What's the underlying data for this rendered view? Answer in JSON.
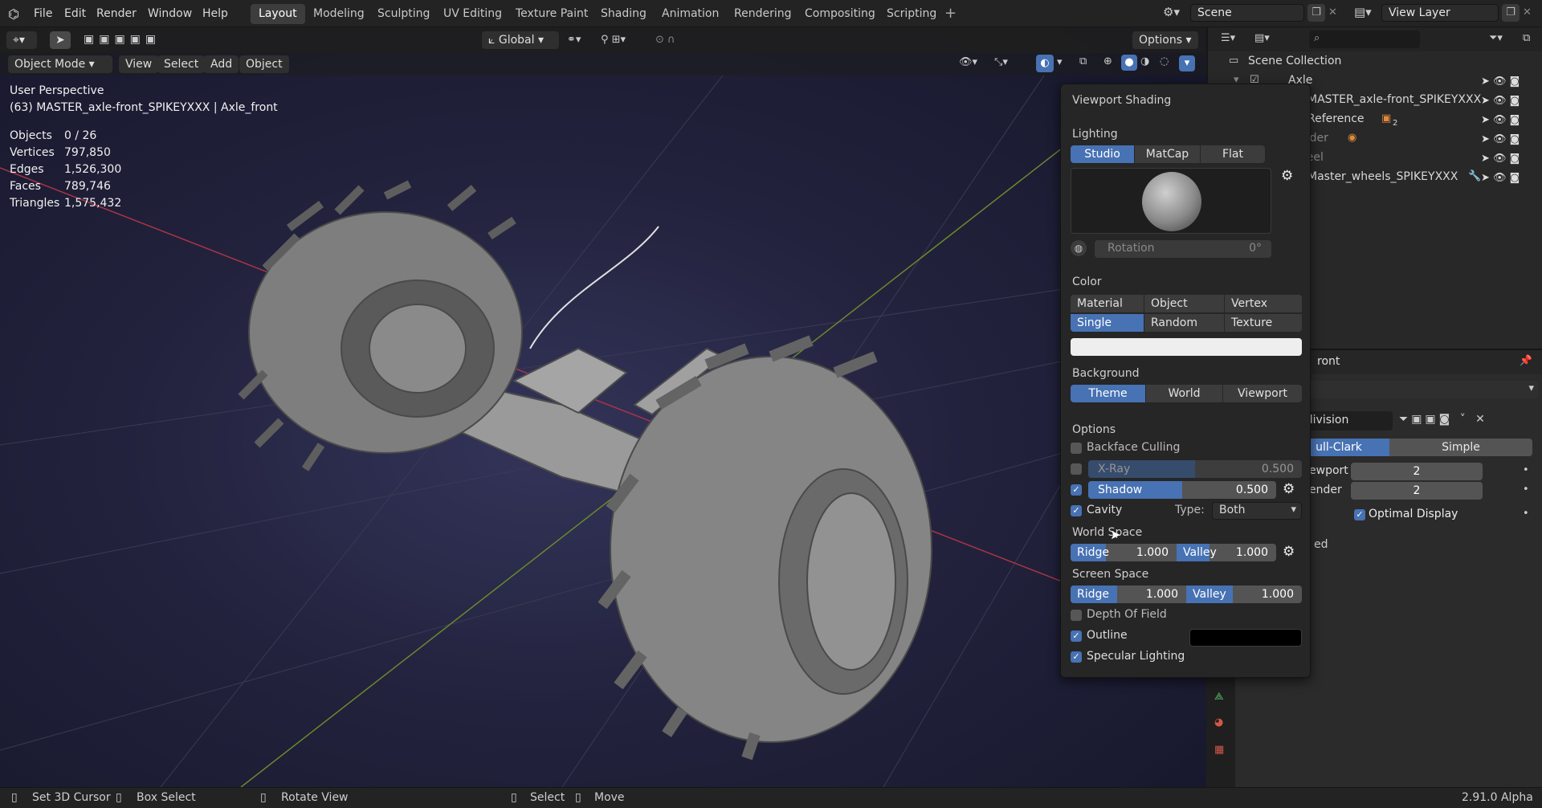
{
  "menu": [
    "File",
    "Edit",
    "Render",
    "Window",
    "Help"
  ],
  "workspaces": [
    "Layout",
    "Modeling",
    "Sculpting",
    "UV Editing",
    "Texture Paint",
    "Shading",
    "Animation",
    "Rendering",
    "Compositing",
    "Scripting"
  ],
  "active_workspace": "Layout",
  "scene": "Scene",
  "view_layer": "View Layer",
  "toolbar": {
    "orientation": "Global",
    "options": "Options"
  },
  "viewport_header": {
    "mode": "Object Mode",
    "view": "View",
    "select": "Select",
    "add": "Add",
    "object": "Object"
  },
  "overlay": {
    "perspective": "User Perspective",
    "object_info": "(63) MASTER_axle-front_SPIKEYXXX | Axle_front",
    "stats": [
      {
        "label": "Objects",
        "value": "0 / 26"
      },
      {
        "label": "Vertices",
        "value": "797,850"
      },
      {
        "label": "Edges",
        "value": "1,526,300"
      },
      {
        "label": "Faces",
        "value": "789,746"
      },
      {
        "label": "Triangles",
        "value": "1,575,432"
      }
    ]
  },
  "shading": {
    "title": "Viewport Shading",
    "lighting_label": "Lighting",
    "lighting": [
      "Studio",
      "MatCap",
      "Flat"
    ],
    "rotation_label": "Rotation",
    "rotation_value": "0°",
    "color_label": "Color",
    "color_row1": [
      "Material",
      "Object",
      "Vertex"
    ],
    "color_row2": [
      "Single",
      "Random",
      "Texture"
    ],
    "background_label": "Background",
    "background": [
      "Theme",
      "World",
      "Viewport"
    ],
    "options_label": "Options",
    "backface": "Backface Culling",
    "xray_label": "X-Ray",
    "xray_value": "0.500",
    "shadow_label": "Shadow",
    "shadow_value": "0.500",
    "cavity": "Cavity",
    "type_label": "Type:",
    "type_value": "Both",
    "world_space": "World Space",
    "ridge": "Ridge",
    "valley": "Valley",
    "ws_ridge": "1.000",
    "ws_valley": "1.000",
    "screen_space": "Screen Space",
    "ss_ridge": "1.000",
    "ss_valley": "1.000",
    "dof": "Depth Of Field",
    "outline": "Outline",
    "specular": "Specular Lighting"
  },
  "outliner": {
    "root": "Scene Collection",
    "items": [
      "Axle",
      "MASTER_axle-front_SPIKEYXXX",
      "Reference",
      "Render",
      "Wheel",
      "Master_wheels_SPIKEYXXX"
    ],
    "badge": "2"
  },
  "properties": {
    "obj_name": "ront",
    "modifier_name": "ubdivision",
    "catmull": "ull-Clark",
    "simple": "Simple",
    "viewport_label": "ewport",
    "viewport_value": "2",
    "render_label": "ender",
    "render_value": "2",
    "optimal": "Optimal Display",
    "used": "ed"
  },
  "statusbar": {
    "set_cursor": "Set 3D Cursor",
    "box_select": "Box Select",
    "rotate_view": "Rotate View",
    "select": "Select",
    "move": "Move",
    "version": "2.91.0 Alpha"
  },
  "colors": {
    "accent": "#4772b3",
    "viewport_bg": "#22223d"
  }
}
